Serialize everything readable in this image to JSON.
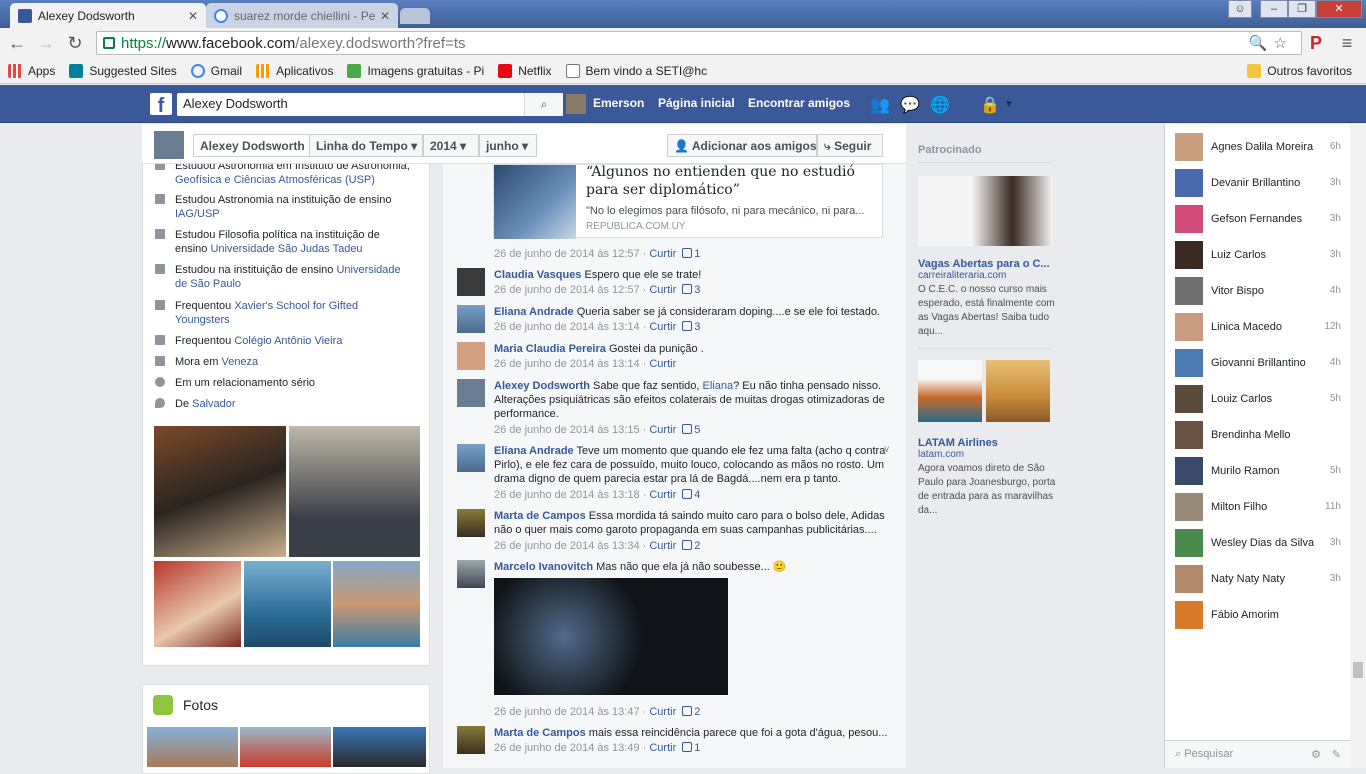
{
  "browser": {
    "active_tab": {
      "title": "Alexey Dodsworth"
    },
    "inactive_tab": {
      "title": "suarez morde chiellini - Pe"
    },
    "url_https": "https://",
    "url_domain": "www.facebook.com",
    "url_path": "/alexey.dodsworth?fref=ts",
    "bookmarks": [
      "Apps",
      "Suggested Sites",
      "Gmail",
      "Aplicativos",
      "Imagens gratuitas - Pi",
      "Netflix",
      "Bem vindo a SETI@hc"
    ],
    "other_bookmarks": "Outros favoritos"
  },
  "fb": {
    "search_value": "Alexey Dodsworth",
    "user": "Emerson",
    "home": "Página inicial",
    "find_friends": "Encontrar amigos"
  },
  "timeline": {
    "name": "Alexey Dodsworth",
    "section": "Linha do Tempo",
    "year": "2014",
    "month": "junho",
    "add_friend": "Adicionar aos amigos",
    "follow": "Seguir"
  },
  "about": {
    "i0_a": "Estudou Astronomia em Instituto de Astronomia,",
    "i0_b": "Geofísica e Ciências Atmosféricas (USP)",
    "i1_a": "Estudou Astronomia na instituição de ensino",
    "i1_b": "IAG/USP",
    "i2_a": "Estudou Filosofia política na instituição de ensino",
    "i2_b": "Universidade São Judas Tadeu",
    "i3_a": "Estudou na instituição de ensino",
    "i3_b": "Universidade",
    "i3_c": "de São Paulo",
    "i4_a": "Frequentou",
    "i4_b": "Xavier's School for Gifted",
    "i4_c": "Youngsters",
    "i5_a": "Frequentou",
    "i5_b": "Colégio Antônio Vieira",
    "i6_a": "Mora em",
    "i6_b": "Veneza",
    "i7_a": "Em um relacionamento sério",
    "i8_a": "De",
    "i8_b": "Salvador",
    "fotos_title": "Fotos"
  },
  "link": {
    "title": "“Algunos no entienden que no estudió para ser diplomático”",
    "desc": "\"No lo elegimos para filósofo, ni para mecánico, ni para...",
    "source": "REPUBLICA.COM.UY",
    "meta": "26 de junho de 2014 às 12:57 ·",
    "likes": "1"
  },
  "comments": [
    {
      "name": "Claudia Vasques",
      "text": "Espero que ele se trate!",
      "time": "26 de junho de 2014 às 12:57 ·",
      "likes": "3"
    },
    {
      "name": "Eliana Andrade",
      "text": "Queria saber se já consideraram doping....e se ele foi testado.",
      "time": "26 de junho de 2014 às 13:14 ·",
      "likes": "3"
    },
    {
      "name": "Maria Claudia Pereira",
      "text": "Gostei da punição .",
      "time": "26 de junho de 2014 às 13:14 ·",
      "likes": ""
    },
    {
      "name": "Alexey Dodsworth",
      "text_a": "Sabe que faz sentido,",
      "mention": "Eliana",
      "text_b": "? Eu não tinha pensado nisso. Alterações psiquiátricas são efeitos colaterais de muitas drogas otimizadoras de performance.",
      "time": "26 de junho de 2014 às 13:15 ·",
      "likes": "5"
    },
    {
      "name": "Eliana Andrade",
      "text": "Teve um momento que quando ele fez uma falta (acho q contra Pirlo), e ele fez cara de possuído, muito louco, colocando as mãos no rosto. Um drama digno de quem parecia estar pra lá de Bagdá....nem era p tanto.",
      "time": "26 de junho de 2014 às 13:18 ·",
      "likes": "4"
    },
    {
      "name": "Marta de Campos",
      "text": "Essa mordida tá saindo muito caro para o bolso dele, Adidas não o quer mais como garoto propaganda em suas campanhas publicitárias....",
      "time": "26 de junho de 2014 às 13:34 ·",
      "likes": "2"
    },
    {
      "name": "Marcelo Ivanovitch",
      "text": "Mas não que ela já não soubesse... 🙂",
      "time": "26 de junho de 2014 às 13:47 ·",
      "likes": "2"
    },
    {
      "name": "Marta de Campos",
      "text": "mais essa reincidência parece que foi a gota d'água, pesou...",
      "time": "26 de junho de 2014 às 13:49 ·",
      "likes": "1"
    }
  ],
  "like_label": "Curtir",
  "ads": {
    "heading": "Patrocinado",
    "ad1_title": "Vagas Abertas para o C...",
    "ad1_domain": "carreiraliteraria.com",
    "ad1_text": "O C.E.C. o nosso curso mais esperado, está finalmente com as Vagas Abertas! Saiba tudo aqu...",
    "ad2_title": "LATAM Airlines",
    "ad2_domain": "latam.com",
    "ad2_text": "Agora voamos direto de São Paulo para Joanesburgo, porta de entrada para as maravilhas da..."
  },
  "chat": {
    "friends": [
      {
        "name": "Agnes Dalila Moreira",
        "time": "6h"
      },
      {
        "name": "Devanir Brillantino",
        "time": "3h"
      },
      {
        "name": "Gefson Fernandes",
        "time": "3h"
      },
      {
        "name": "Luiz Carlos",
        "time": "3h"
      },
      {
        "name": "Vitor Bispo",
        "time": "4h"
      },
      {
        "name": "Linica Macedo",
        "time": "12h"
      },
      {
        "name": "Giovanni Brillantino",
        "time": "4h"
      },
      {
        "name": "Louiz Carlos",
        "time": "5h"
      },
      {
        "name": "Brendinha Mello",
        "time": ""
      },
      {
        "name": "Murilo Ramon",
        "time": "5h"
      },
      {
        "name": "Milton Filho",
        "time": "11h"
      },
      {
        "name": "Wesley Dias da Silva",
        "time": "3h"
      },
      {
        "name": "Naty Naty Naty",
        "time": "3h"
      },
      {
        "name": "Fábio Amorim",
        "time": ""
      }
    ],
    "search_placeholder": "Pesquisar"
  }
}
